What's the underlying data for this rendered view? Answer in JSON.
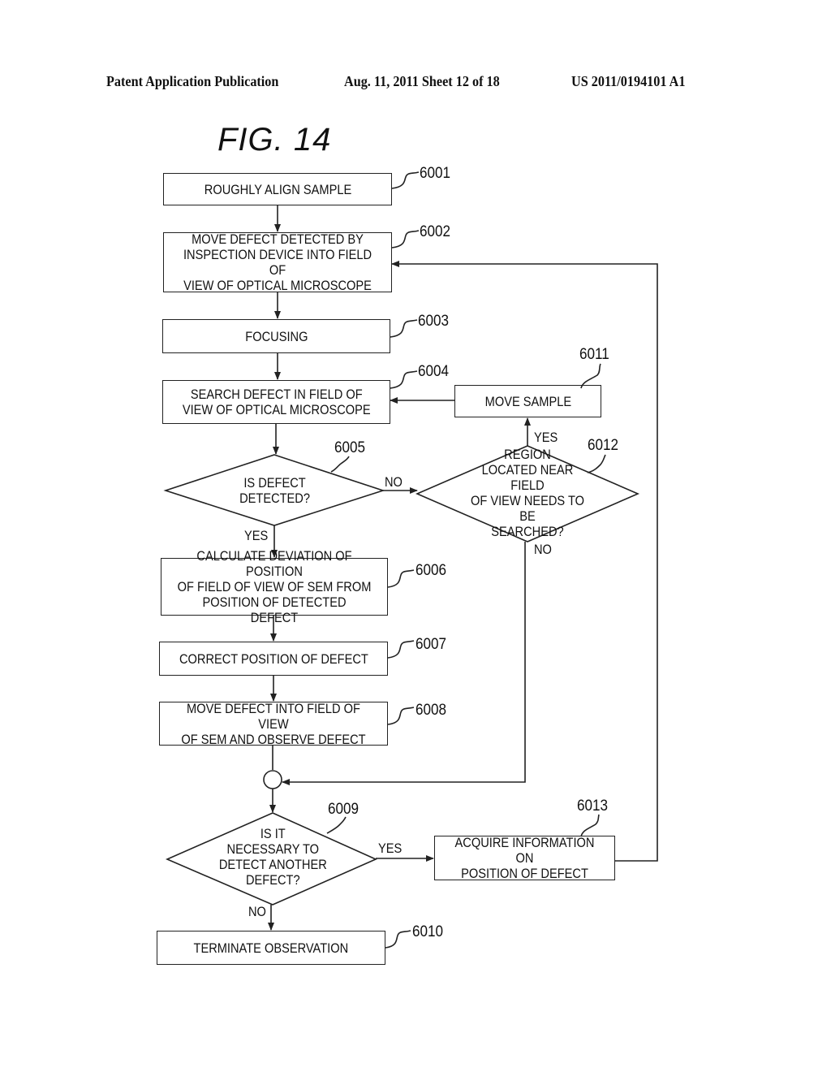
{
  "header": {
    "publication": "Patent Application Publication",
    "date_sheet": "Aug. 11, 2011  Sheet 12 of 18",
    "patent_number": "US 2011/0194101 A1"
  },
  "figure": {
    "title": "FIG.  14"
  },
  "steps": {
    "s6001": {
      "ref": "6001",
      "text": "ROUGHLY ALIGN SAMPLE"
    },
    "s6002": {
      "ref": "6002",
      "text": "MOVE DEFECT DETECTED BY\nINSPECTION DEVICE INTO FIELD OF\nVIEW OF OPTICAL MICROSCOPE"
    },
    "s6003": {
      "ref": "6003",
      "text": "FOCUSING"
    },
    "s6004": {
      "ref": "6004",
      "text": "SEARCH DEFECT IN FIELD OF\nVIEW OF OPTICAL MICROSCOPE"
    },
    "s6005": {
      "ref": "6005",
      "text": "IS DEFECT\nDETECTED?"
    },
    "s6006": {
      "ref": "6006",
      "text": "CALCULATE DEVIATION OF POSITION\nOF FIELD OF VIEW OF SEM FROM\nPOSITION OF DETECTED DEFECT"
    },
    "s6007": {
      "ref": "6007",
      "text": "CORRECT POSITION OF DEFECT"
    },
    "s6008": {
      "ref": "6008",
      "text": "MOVE DEFECT INTO FIELD OF VIEW\nOF SEM AND OBSERVE DEFECT"
    },
    "s6009": {
      "ref": "6009",
      "text": "IS IT\nNECESSARY TO\nDETECT ANOTHER\nDEFECT?"
    },
    "s6010": {
      "ref": "6010",
      "text": "TERMINATE OBSERVATION"
    },
    "s6011": {
      "ref": "6011",
      "text": "MOVE SAMPLE"
    },
    "s6012": {
      "ref": "6012",
      "text": "REGION\nLOCATED NEAR FIELD\nOF VIEW NEEDS TO BE\nSEARCHED?"
    },
    "s6013": {
      "ref": "6013",
      "text": "ACQUIRE INFORMATION ON\nPOSITION OF DEFECT"
    }
  },
  "edge_labels": {
    "d6005_no": "NO",
    "d6005_yes": "YES",
    "d6012_yes": "YES",
    "d6012_no": "NO",
    "d6009_yes": "YES",
    "d6009_no": "NO"
  }
}
